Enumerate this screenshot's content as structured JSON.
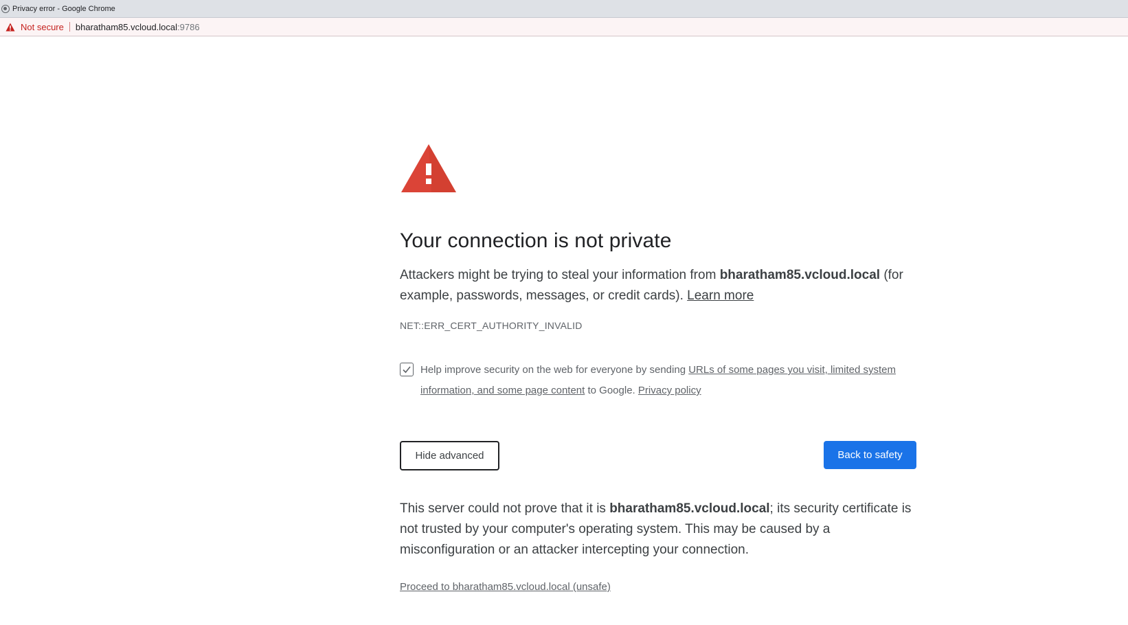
{
  "window": {
    "title": "Privacy error - Google Chrome"
  },
  "addressbar": {
    "security_label": "Not secure",
    "host": "bharatham85.vcloud.local",
    "port": ":9786"
  },
  "page": {
    "heading": "Your connection is not private",
    "intro_before": "Attackers might be trying to steal your information from ",
    "intro_host": "bharatham85.vcloud.local",
    "intro_after": " (for example, passwords, messages, or credit cards). ",
    "learn_more": "Learn more",
    "error_code": "NET::ERR_CERT_AUTHORITY_INVALID",
    "optin": {
      "checked": true,
      "before": "Help improve security on the web for everyone by sending ",
      "link": "URLs of some pages you visit, limited system information, and some page content",
      "after": " to Google. ",
      "privacy_link": "Privacy policy"
    },
    "hide_advanced": "Hide advanced",
    "back_to_safety": "Back to safety",
    "detail_before": "This server could not prove that it is ",
    "detail_host": "bharatham85.vcloud.local",
    "detail_after": "; its security certificate is not trusted by your computer's operating system. This may be caused by a misconfiguration or an attacker intercepting your connection.",
    "proceed_link": "Proceed to bharatham85.vcloud.local (unsafe)"
  },
  "colors": {
    "warning_red": "#db4437",
    "primary_blue": "#1a73e8",
    "not_secure_red": "#c5221f"
  },
  "icons": {
    "tab": "chrome-icon",
    "address_warning": "warning-triangle-icon",
    "main": "warning-triangle-icon",
    "checkbox": "checkmark-icon"
  }
}
